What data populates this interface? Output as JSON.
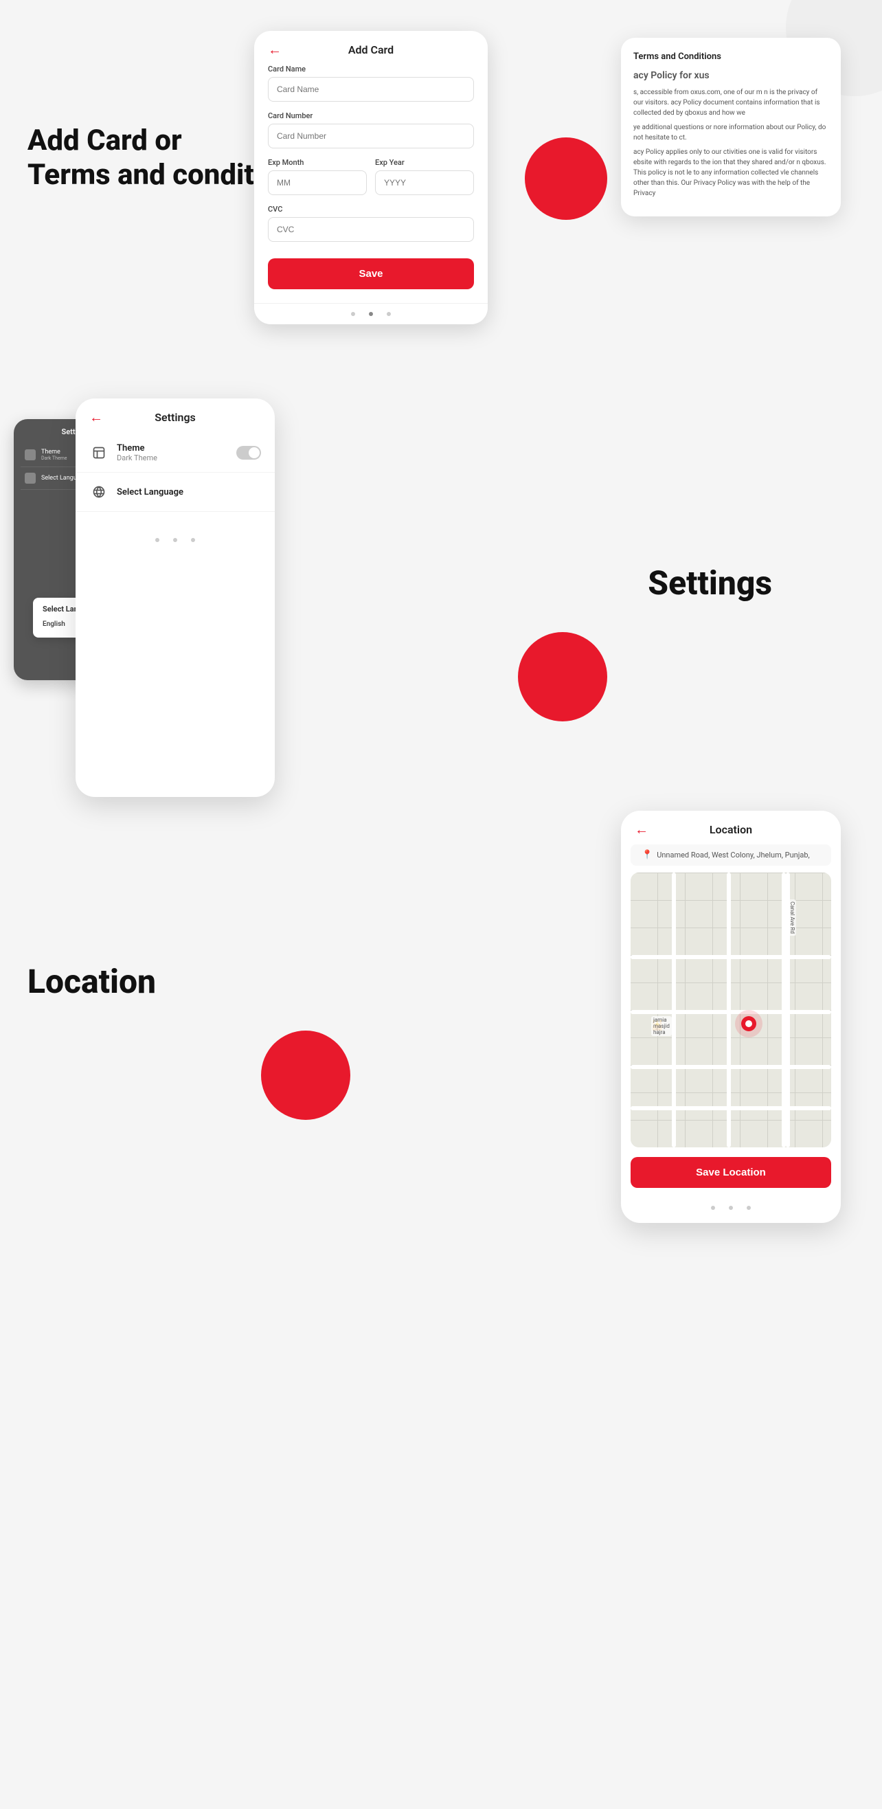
{
  "section1": {
    "label_line1": "Add Card or",
    "label_line2": "Terms and condition",
    "add_card": {
      "title": "Add Card",
      "back_icon": "←",
      "card_name_label": "Card Name",
      "card_name_placeholder": "Card Name",
      "card_number_label": "Card Number",
      "card_number_placeholder": "Card Number",
      "exp_month_label": "Exp Month",
      "exp_month_placeholder": "MM",
      "exp_year_label": "Exp Year",
      "exp_year_placeholder": "YYYY",
      "cvc_label": "CVC",
      "cvc_placeholder": "CVC",
      "save_button": "Save"
    },
    "terms": {
      "title": "Terms and Conditions",
      "heading": "acy Policy for xus",
      "paragraphs": [
        "s, accessible from oxus.com, one of our m n is the privacy of our visitors. acy Policy document contains  information that is collected ded by qboxus and how we",
        "ye additional questions or nore information about our Policy, do not hesitate to ct.",
        "acy Policy applies only to our ctivities one is valid for visitors ebsite with regards to the ion that they shared and/or n qboxus. This policy is not le to any information collected vle channels other than this. Our Privacy Policy was with the help of the Privacy"
      ]
    }
  },
  "section2": {
    "label": "Settings",
    "settings_screen": {
      "title": "Settings",
      "back_icon": "←",
      "theme_row": {
        "icon": "🎨",
        "title": "Theme",
        "subtitle": "Dark Theme",
        "toggle_state": "off"
      },
      "language_row": {
        "icon": "🌐",
        "title": "Select Language"
      }
    },
    "behind_screen": {
      "title": "Settings",
      "rows": [
        {
          "label": "Theme",
          "sub": "Dark Theme"
        },
        {
          "label": "Select Language",
          "sub": ""
        }
      ]
    },
    "language_dropdown": {
      "title": "Select Language",
      "option": "English"
    }
  },
  "section3": {
    "label": "Location",
    "location_screen": {
      "title": "Location",
      "back_icon": "←",
      "address": "Unnamed Road, West Colony, Jhelum, Punjab,",
      "address_icon": "📍",
      "map_label": "jamia masjid hajra",
      "save_button": "Save Location"
    }
  }
}
